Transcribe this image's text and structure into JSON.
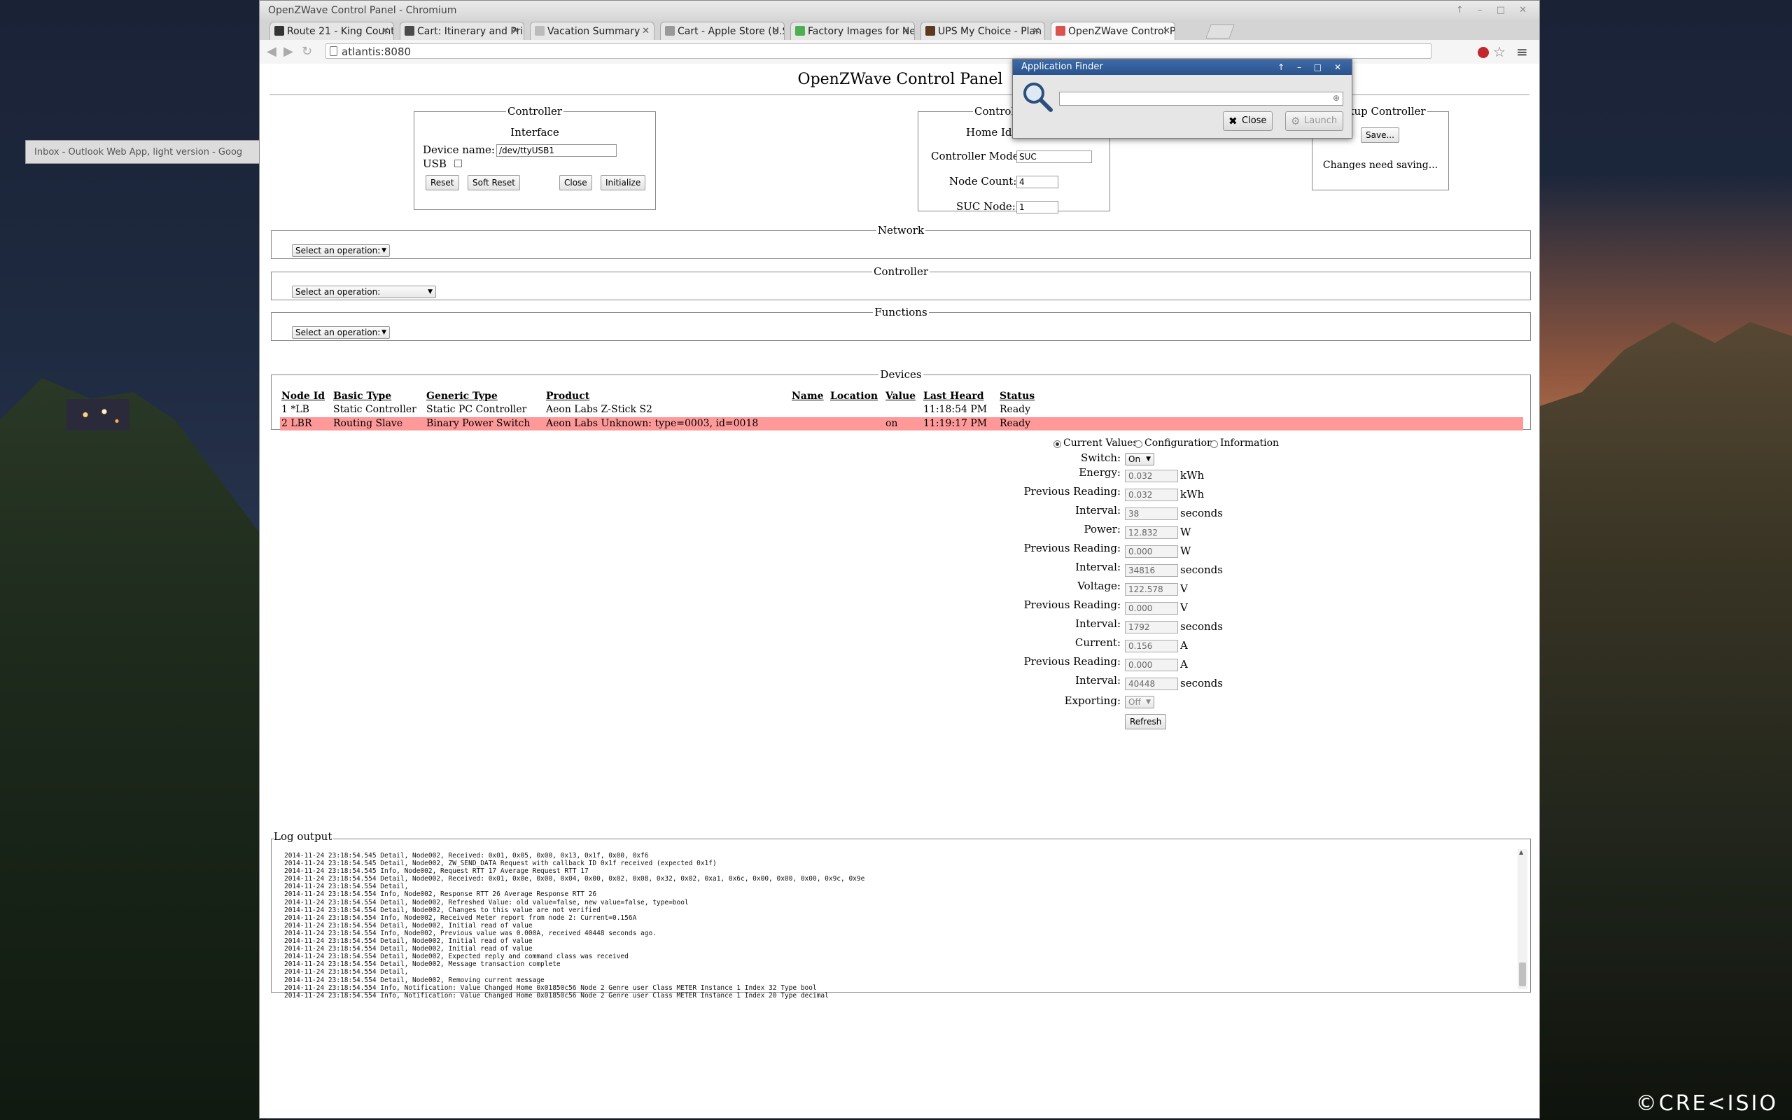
{
  "desktop": {
    "watermark": "©CRE<ISIO",
    "background_window_title": "Inbox - Outlook Web App, light version - Goog"
  },
  "browser": {
    "window_title": "OpenZWave Control Panel - Chromium",
    "tabs": [
      {
        "label": "Route 21 - King Count",
        "favicon_color": "#333333"
      },
      {
        "label": "Cart: Itinerary and Pric",
        "favicon_color": "#4a4a4a"
      },
      {
        "label": "Vacation Summary",
        "favicon_color": "#bbbbbb"
      },
      {
        "label": "Cart - Apple Store (U.S",
        "favicon_color": "#999999"
      },
      {
        "label": "Factory Images for Ne",
        "favicon_color": "#4caf50"
      },
      {
        "label": "UPS My Choice - Plan",
        "favicon_color": "#5b3a1e"
      },
      {
        "label": "OpenZWave Control P",
        "favicon_color": "#d9534f",
        "active": true
      }
    ],
    "url": "atlantis:8080"
  },
  "page": {
    "title": "OpenZWave Control Panel",
    "controller_box": {
      "legend": "Controller",
      "subtitle": "Interface",
      "device_name_label": "Device name:",
      "device_name_value": "/dev/ttyUSB1",
      "usb_label": "USB",
      "usb_checked": false,
      "buttons": [
        "Reset",
        "Soft Reset",
        "Close",
        "Initialize"
      ]
    },
    "controller_info": {
      "legend": "Controlle",
      "home_id_label": "Home Id:",
      "controller_mode_label": "Controller Mode:",
      "controller_mode_value": "SUC",
      "node_count_label": "Node Count:",
      "node_count_value": "4",
      "suc_node_label": "SUC Node:",
      "suc_node_value": "1"
    },
    "backup_box": {
      "legend": "ckup Controller",
      "save_button": "Save...",
      "status": "Changes need saving..."
    },
    "network": {
      "legend": "Network",
      "select_value": "Select an operation:"
    },
    "controller_ops": {
      "legend": "Controller",
      "select_value": "Select an operation:"
    },
    "functions": {
      "legend": "Functions",
      "select_value": "Select an operation:"
    },
    "devices": {
      "legend": "Devices",
      "columns": [
        "Node Id",
        "Basic Type",
        "Generic Type",
        "Product",
        "Name",
        "Location",
        "Value",
        "Last Heard",
        "Status"
      ],
      "rows": [
        {
          "node_id": "1 *LB",
          "basic_type": "Static Controller",
          "generic_type": "Static PC Controller",
          "product": "Aeon Labs Z-Stick S2",
          "name": "",
          "location": "",
          "value": "",
          "last_heard": "11:18:54 PM",
          "status": "Ready",
          "selected": false
        },
        {
          "node_id": "2 LBR",
          "basic_type": "Routing Slave",
          "generic_type": "Binary Power Switch",
          "product": "Aeon Labs Unknown: type=0003, id=0018",
          "name": "",
          "location": "",
          "value": "on",
          "last_heard": "11:19:17 PM",
          "status": "Ready",
          "selected": true
        }
      ]
    },
    "value_tabs": {
      "options": [
        "Current Values",
        "Configuration",
        "Information"
      ],
      "selected": "Current Values"
    },
    "values": {
      "switch_label": "Switch:",
      "switch_value": "On",
      "fields": [
        {
          "label": "Energy:",
          "value": "0.032",
          "unit": "kWh"
        },
        {
          "label": "Previous Reading:",
          "value": "0.032",
          "unit": "kWh"
        },
        {
          "label": "Interval:",
          "value": "38",
          "unit": "seconds"
        },
        {
          "label": "Power:",
          "value": "12.832",
          "unit": "W"
        },
        {
          "label": "Previous Reading:",
          "value": "0.000",
          "unit": "W"
        },
        {
          "label": "Interval:",
          "value": "34816",
          "unit": "seconds"
        },
        {
          "label": "Voltage:",
          "value": "122.578",
          "unit": "V"
        },
        {
          "label": "Previous Reading:",
          "value": "0.000",
          "unit": "V"
        },
        {
          "label": "Interval:",
          "value": "1792",
          "unit": "seconds"
        },
        {
          "label": "Current:",
          "value": "0.156",
          "unit": "A"
        },
        {
          "label": "Previous Reading:",
          "value": "0.000",
          "unit": "A"
        },
        {
          "label": "Interval:",
          "value": "40448",
          "unit": "seconds"
        }
      ],
      "exporting_label": "Exporting:",
      "exporting_value": "Off",
      "refresh_button": "Refresh"
    },
    "log": {
      "legend": "Log output",
      "lines": [
        "2014-11-24 23:18:54.545 Detail, Node002, Received: 0x01, 0x05, 0x00, 0x13, 0x1f, 0x00, 0xf6",
        "2014-11-24 23:18:54.545 Detail, Node002, ZW_SEND_DATA Request with callback ID 0x1f received (expected 0x1f)",
        "2014-11-24 23:18:54.545 Info, Node002, Request RTT 17 Average Request RTT 17",
        "2014-11-24 23:18:54.554 Detail, Node002, Received: 0x01, 0x0e, 0x00, 0x04, 0x00, 0x02, 0x08, 0x32, 0x02, 0xa1, 0x6c, 0x00, 0x00, 0x00, 0x9c, 0x9e",
        "2014-11-24 23:18:54.554 Detail,",
        "2014-11-24 23:18:54.554 Info, Node002, Response RTT 26 Average Response RTT 26",
        "2014-11-24 23:18:54.554 Detail, Node002, Refreshed Value: old value=false, new value=false, type=bool",
        "2014-11-24 23:18:54.554 Detail, Node002, Changes to this value are not verified",
        "2014-11-24 23:18:54.554 Info, Node002, Received Meter report from node 2: Current=0.156A",
        "2014-11-24 23:18:54.554 Detail, Node002, Initial read of value",
        "2014-11-24 23:18:54.554 Info, Node002, Previous value was 0.000A, received 40448 seconds ago.",
        "2014-11-24 23:18:54.554 Detail, Node002, Initial read of value",
        "2014-11-24 23:18:54.554 Detail, Node002, Initial read of value",
        "2014-11-24 23:18:54.554 Detail, Node002, Expected reply and command class was received",
        "2014-11-24 23:18:54.554 Detail, Node002, Message transaction complete",
        "2014-11-24 23:18:54.554 Detail,",
        "2014-11-24 23:18:54.554 Detail, Node002, Removing current message",
        "2014-11-24 23:18:54.554 Info, Notification: Value Changed Home 0x01850c56 Node 2 Genre user Class METER Instance 1 Index 32 Type bool",
        "2014-11-24 23:18:54.554 Info, Notification: Value Changed Home 0x01850c56 Node 2 Genre user Class METER Instance 1 Index 20 Type decimal"
      ]
    }
  },
  "app_finder": {
    "title": "Application Finder",
    "search_value": "",
    "close_button": "Close",
    "launch_button": "Launch"
  }
}
